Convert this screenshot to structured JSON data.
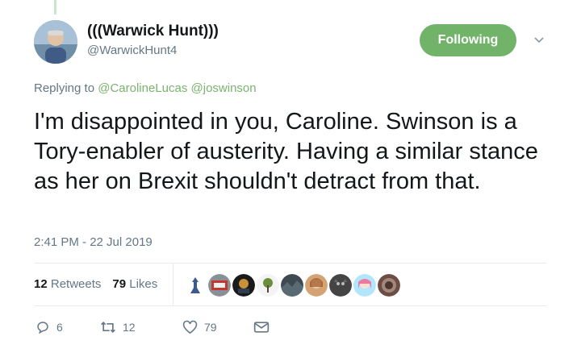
{
  "tweet": {
    "display_name": "(((Warwick Hunt)))",
    "handle": "@WarwickHunt4",
    "follow_label": "Following",
    "replying_prefix": "Replying to",
    "replying_to": [
      "@CarolineLucas",
      "@joswinson"
    ],
    "text": "I'm disappointed in you, Caroline. Swinson is a Tory-enabler of austerity. Having a similar stance as her on Brexit shouldn't detract from that.",
    "timestamp": "2:41 PM - 22 Jul 2019"
  },
  "stats": {
    "retweets_count": "12",
    "retweets_label": "Retweets",
    "likes_count": "79",
    "likes_label": "Likes"
  },
  "actions": {
    "reply_count": "6",
    "retweet_count": "12",
    "like_count": "79"
  },
  "colors": {
    "accent": "#72b36a",
    "link": "#7bb36f",
    "secondary_text": "#657786"
  },
  "icons": [
    "chevron-down-icon",
    "reply-icon",
    "retweet-icon",
    "like-icon",
    "message-icon"
  ]
}
